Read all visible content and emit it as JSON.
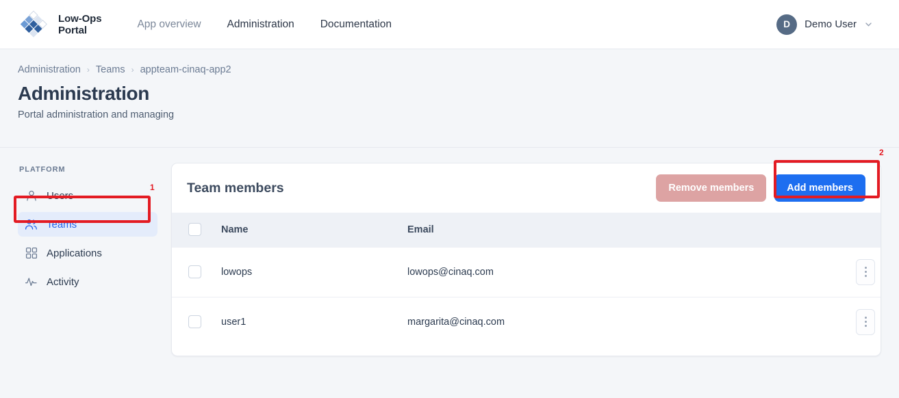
{
  "header": {
    "brand_line1": "Low-Ops",
    "brand_line2": "Portal",
    "nav": [
      {
        "label": "App overview",
        "active": false
      },
      {
        "label": "Administration",
        "active": true
      },
      {
        "label": "Documentation",
        "active": false
      }
    ],
    "user": {
      "initial": "D",
      "name": "Demo User"
    }
  },
  "page": {
    "breadcrumb": [
      "Administration",
      "Teams",
      "appteam-cinaq-app2"
    ],
    "breadcrumb_separator": "›",
    "title": "Administration",
    "subtitle": "Portal administration and managing"
  },
  "sidebar": {
    "section_label": "PLATFORM",
    "items": [
      {
        "label": "Users",
        "icon": "user-icon"
      },
      {
        "label": "Teams",
        "icon": "users-group-icon"
      },
      {
        "label": "Applications",
        "icon": "grid-icon"
      },
      {
        "label": "Activity",
        "icon": "activity-pulse-icon"
      }
    ]
  },
  "card": {
    "title": "Team members",
    "remove_label": "Remove members",
    "add_label": "Add members",
    "columns": [
      "Name",
      "Email"
    ],
    "rows": [
      {
        "name": "lowops",
        "email": "lowops@cinaq.com"
      },
      {
        "name": "user1",
        "email": "margarita@cinaq.com"
      }
    ]
  },
  "annotations": [
    {
      "number": "1",
      "target": "sidebar-item-teams"
    },
    {
      "number": "2",
      "target": "add-members-button"
    }
  ],
  "colors": {
    "accent_blue": "#1d6ef0",
    "annotation_red": "#e31b23",
    "remove_red": "#dda3a3",
    "active_bg": "#e4ecfb"
  }
}
